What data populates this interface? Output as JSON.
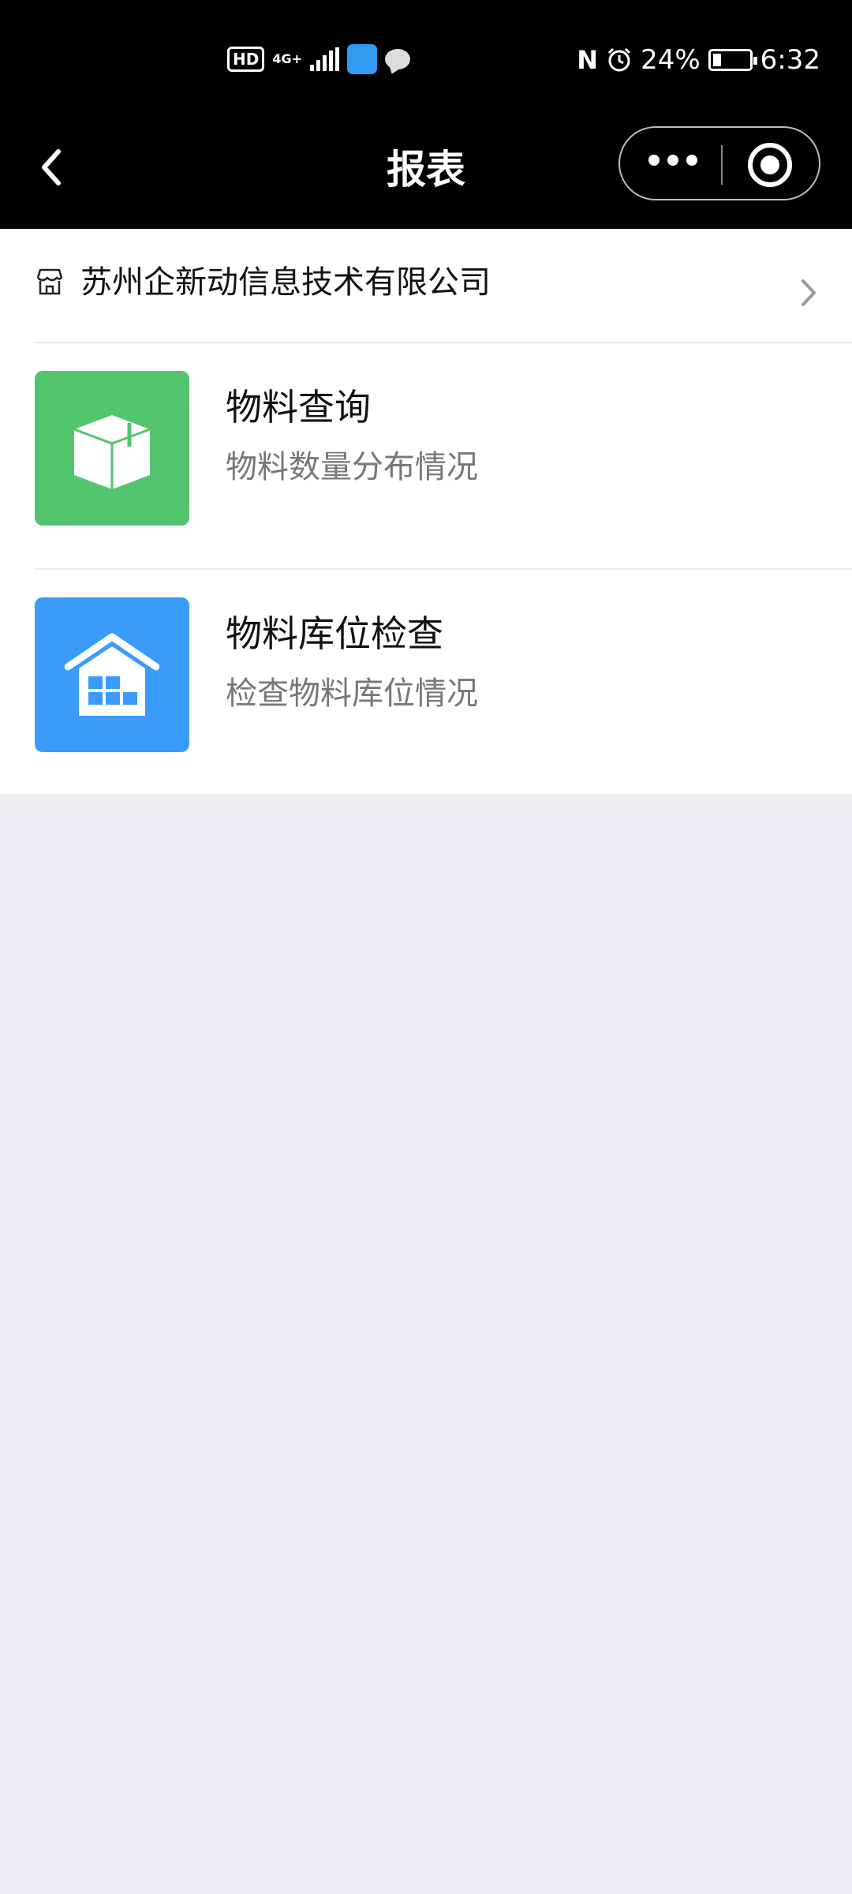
{
  "status_bar": {
    "hd_badge": "HD",
    "network_badge": "4G+",
    "nfc": "N",
    "battery_percent": "24%",
    "time": "6:32",
    "battery_level": 0.24
  },
  "nav": {
    "title": "报表",
    "back_icon": "chevron-left-icon",
    "more_icon": "more-dots-icon",
    "close_icon": "target-close-icon"
  },
  "company": {
    "name": "苏州企新动信息技术有限公司",
    "icon": "storefront-icon"
  },
  "menu": {
    "items": [
      {
        "title": "物料查询",
        "subtitle": "物料数量分布情况",
        "icon": "box-icon",
        "color": "#52c46e"
      },
      {
        "title": "物料库位检查",
        "subtitle": "检查物料库位情况",
        "icon": "warehouse-icon",
        "color": "#3a9bfa"
      }
    ]
  },
  "colors": {
    "header_bg": "#000000",
    "page_bg": "#ededf2",
    "card_bg": "#ffffff"
  }
}
